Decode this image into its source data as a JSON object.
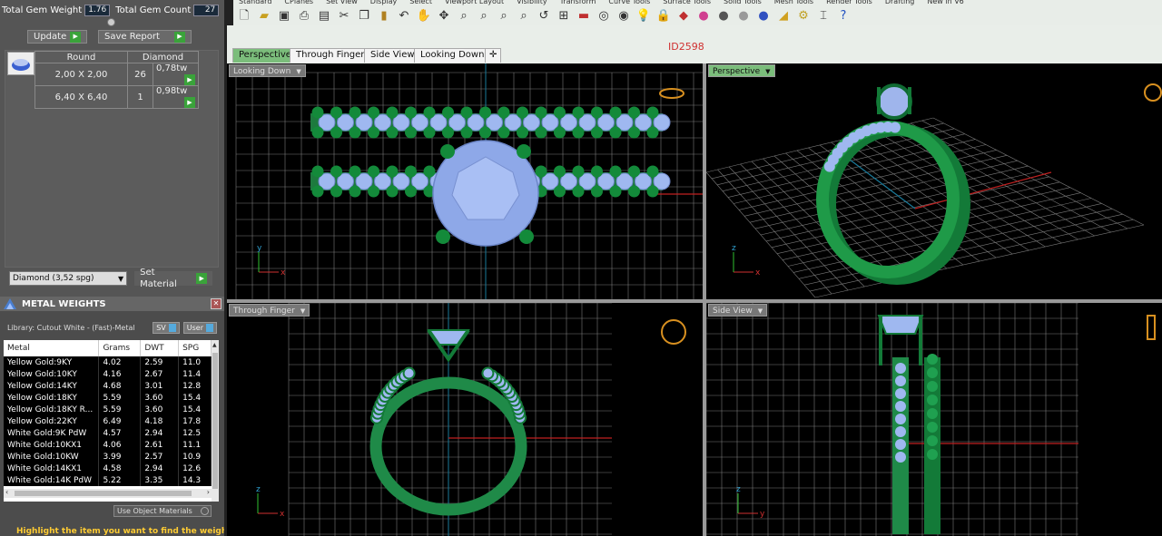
{
  "gem_stats": {
    "total_weight_label": "Total Gem Weight",
    "total_weight_value": "1.76",
    "total_count_label": "Total Gem Count",
    "total_count_value": "27"
  },
  "actions": {
    "update": "Update",
    "save_report": "Save Report"
  },
  "gem_table": {
    "headers": [
      "Round",
      "Diamond"
    ],
    "rows": [
      {
        "size": "2,00 X 2,00",
        "count": "26",
        "weight": "0,78tw"
      },
      {
        "size": "6,40 X 6,40",
        "count": "1",
        "weight": "0,98tw"
      }
    ]
  },
  "material": {
    "selected": "Diamond   (3,52 spg)",
    "set_label": "Set Material"
  },
  "metal_weights": {
    "title": "METAL WEIGHTS",
    "library": "Library: Cutout White - (Fast)-Metal",
    "sv_label": "SV",
    "user_label": "User",
    "columns": [
      "Metal",
      "Grams",
      "DWT",
      "SPG"
    ],
    "rows": [
      [
        "Yellow Gold:9KY",
        "4.02",
        "2.59",
        "11.0"
      ],
      [
        "Yellow Gold:10KY",
        "4.16",
        "2.67",
        "11.4"
      ],
      [
        "Yellow Gold:14KY",
        "4.68",
        "3.01",
        "12.8"
      ],
      [
        "Yellow Gold:18KY",
        "5.59",
        "3.60",
        "15.4"
      ],
      [
        "Yellow Gold:18KY R...",
        "5.59",
        "3.60",
        "15.4"
      ],
      [
        "Yellow Gold:22KY",
        "6.49",
        "4.18",
        "17.8"
      ],
      [
        "White Gold:9K PdW",
        "4.57",
        "2.94",
        "12.5"
      ],
      [
        "White Gold:10KX1",
        "4.06",
        "2.61",
        "11.1"
      ],
      [
        "White Gold:10KW",
        "3.99",
        "2.57",
        "10.9"
      ],
      [
        "White Gold:14KX1",
        "4.58",
        "2.94",
        "12.6"
      ],
      [
        "White Gold:14K PdW",
        "5.22",
        "3.35",
        "14.3"
      ]
    ],
    "use_object_materials": "Use Object Materials",
    "hint": "Highlight the item you want to find the weight"
  },
  "menu": [
    "Standard",
    "CPlanes",
    "Set View",
    "Display",
    "Select",
    "Viewport Layout",
    "Visibility",
    "Transform",
    "Curve Tools",
    "Surface Tools",
    "Solid Tools",
    "Mesh Tools",
    "Render Tools",
    "Drafting",
    "New in V6"
  ],
  "document_id": "ID2598",
  "tabs": [
    "Perspective",
    "Through Finger",
    "Side View",
    "Looking Down"
  ],
  "viewports": {
    "top_left": "Looking Down",
    "top_right": "Perspective",
    "bottom_left": "Through Finger",
    "bottom_right": "Side View"
  },
  "axis_labels": {
    "x": "x",
    "y": "y",
    "z": "z"
  },
  "colors": {
    "metal": "#1d7a3e",
    "gem": "#9fb8f0",
    "active_tab": "#7bbd7b",
    "grid": "#7a7a7a"
  }
}
